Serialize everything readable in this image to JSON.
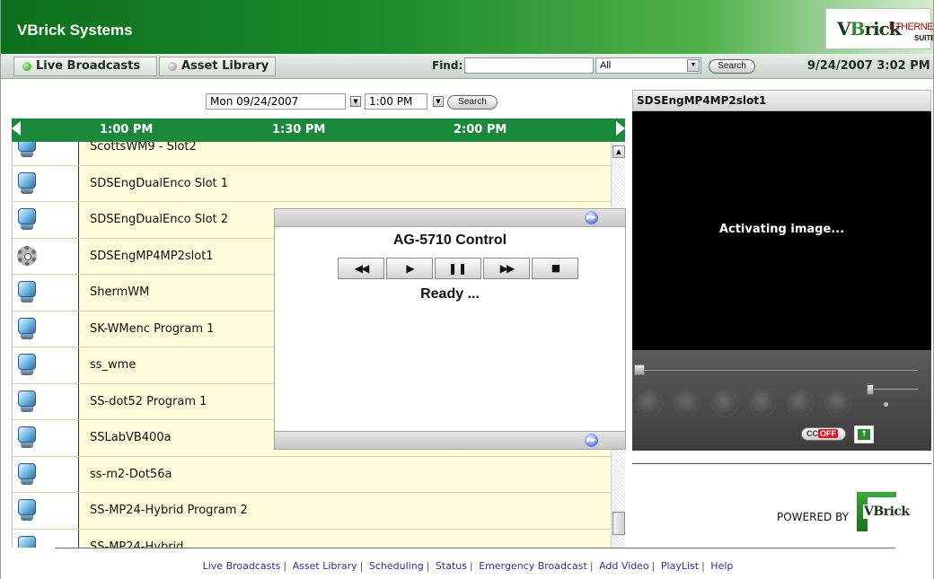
{
  "header": {
    "title": "VBrick Systems",
    "logo_text": "VBrick ETHERNETV SUITE"
  },
  "nav": {
    "tabs": [
      {
        "label": "Live Broadcasts",
        "active": true
      },
      {
        "label": "Asset Library",
        "active": false
      }
    ],
    "find_label": "Find:",
    "find_value": "",
    "scope_value": "All",
    "search_label": "Search",
    "datetime": "9/24/2007 3:02 PM"
  },
  "guide": {
    "date_value": "Mon 09/24/2007",
    "time_value": "1:00 PM",
    "search_label": "Search",
    "time_slots": [
      "1:00 PM",
      "1:30 PM",
      "2:00 PM"
    ],
    "channels": [
      {
        "name": "ScottsWM9 - Slot2",
        "icon": "monitor-icon"
      },
      {
        "name": "SDSEngDualEnco Slot 1",
        "icon": "monitor-icon"
      },
      {
        "name": "SDSEngDualEnco Slot 2",
        "icon": "monitor-icon"
      },
      {
        "name": "SDSEngMP4MP2slot1",
        "icon": "gear-icon"
      },
      {
        "name": "ShermWM",
        "icon": "monitor-icon"
      },
      {
        "name": "SK-WMenc Program 1",
        "icon": "monitor-icon"
      },
      {
        "name": "ss_wme",
        "icon": "monitor-icon"
      },
      {
        "name": "SS-dot52 Program 1",
        "icon": "monitor-icon"
      },
      {
        "name": "SSLabVB400a",
        "icon": "monitor-icon"
      },
      {
        "name": "ss-m2-Dot56a",
        "icon": "monitor-icon"
      },
      {
        "name": "SS-MP24-Hybrid Program 2",
        "icon": "monitor-icon"
      },
      {
        "name": "SS-MP24-Hybrid",
        "icon": "monitor-icon"
      }
    ]
  },
  "control_popup": {
    "title": "AG-5710 Control",
    "buttons": [
      "rewind",
      "play",
      "pause",
      "fast-forward",
      "stop"
    ],
    "status": "Ready ..."
  },
  "player": {
    "title": "SDSEngMP4MP2slot1",
    "message": "Activating image...",
    "cc_label": "CC",
    "cc_state": "OFF",
    "seek_position": 0,
    "powered_by": "POWERED BY",
    "powered_logo": "VBrick"
  },
  "footer": {
    "links": [
      "Live Broadcasts",
      "Asset Library",
      "Scheduling",
      "Status",
      "Emergency Broadcast",
      "Add Video",
      "PlayList",
      "Help"
    ]
  },
  "colors": {
    "header_green": "#1b8a2b",
    "timebar_green": "#1a8a3a",
    "row_yellow": "#fdfbd9",
    "link_blue": "#2a32a8",
    "cc_off_red": "#e0142b"
  }
}
